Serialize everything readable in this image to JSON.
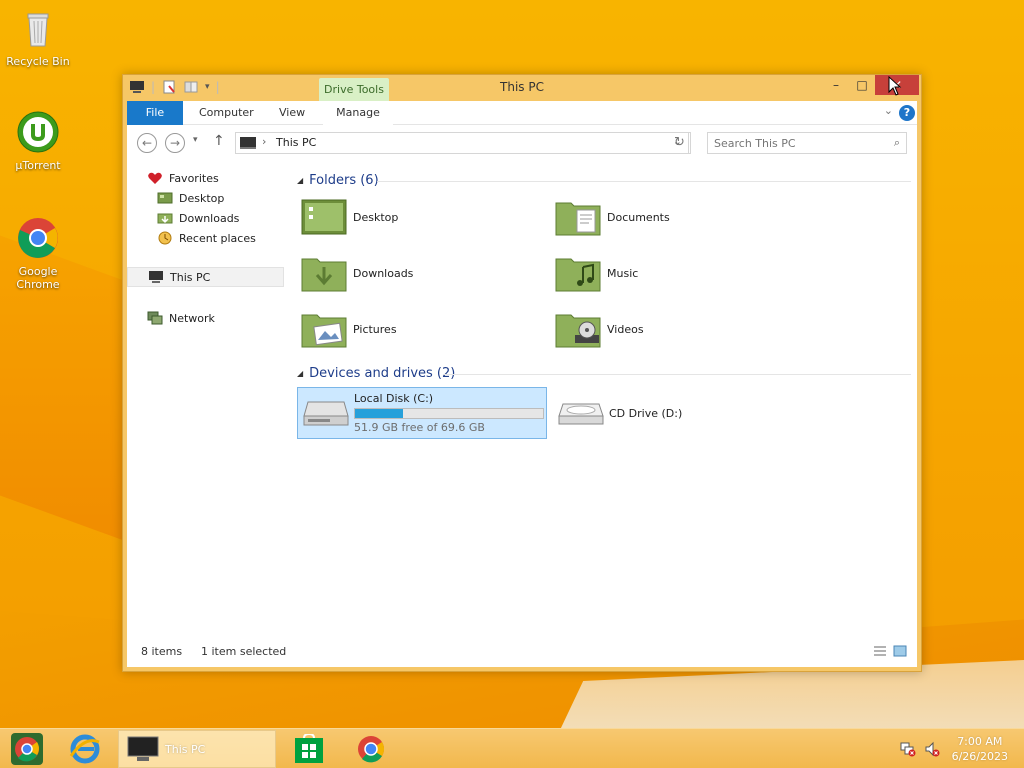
{
  "desktop": {
    "icons": [
      {
        "label": "Recycle Bin",
        "icon": "recycle-bin-icon"
      },
      {
        "label": "µTorrent",
        "icon": "utorrent-icon"
      },
      {
        "label": "Google Chrome",
        "icon": "chrome-icon"
      }
    ]
  },
  "window": {
    "title": "This PC",
    "ribbon": {
      "context_header": "Drive Tools",
      "tabs": [
        "File",
        "Computer",
        "View",
        "Manage"
      ]
    },
    "address": {
      "location": "This PC"
    },
    "search": {
      "placeholder": "Search This PC"
    },
    "nav_pane": {
      "favorites": "Favorites",
      "favorites_items": [
        "Desktop",
        "Downloads",
        "Recent places"
      ],
      "this_pc": "This PC",
      "network": "Network"
    },
    "groups": {
      "folders_header": "Folders (6)",
      "folders": [
        "Desktop",
        "Documents",
        "Downloads",
        "Music",
        "Pictures",
        "Videos"
      ],
      "devices_header": "Devices and drives (2)",
      "drives": [
        {
          "name": "Local Disk (C:)",
          "free_text": "51.9 GB free of 69.6 GB",
          "used_fraction": 0.254
        },
        {
          "name": "CD Drive (D:)"
        }
      ]
    },
    "status": {
      "items": "8 items",
      "selected": "1 item selected"
    }
  },
  "taskbar": {
    "active_window": "This PC",
    "clock_time": "7:00 AM",
    "clock_date": "6/26/2023"
  },
  "colors": {
    "file_tab": "#1979ca",
    "selection": "#cce8ff",
    "close_button": "#c7403a",
    "drive_bar": "#26a0da"
  }
}
